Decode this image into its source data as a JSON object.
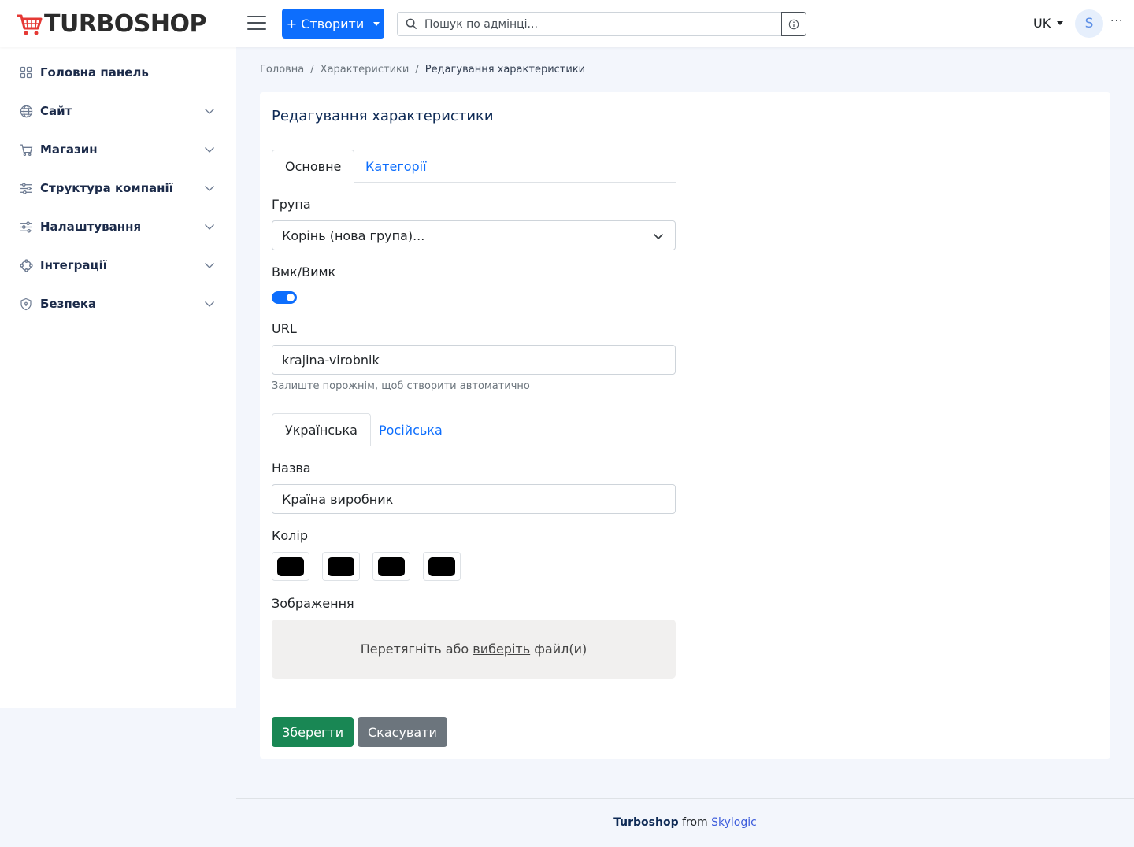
{
  "header": {
    "logo": "TURBOSHOP",
    "create_label": "+ Створити",
    "search_placeholder": "Пошук по адмінці...",
    "language": "UK",
    "avatar_initial": "S",
    "more": "···"
  },
  "sidebar": {
    "items": [
      {
        "label": "Головна панель",
        "icon": "grid-icon",
        "has_children": false
      },
      {
        "label": "Сайт",
        "icon": "globe-icon",
        "has_children": true
      },
      {
        "label": "Магазин",
        "icon": "cart-icon",
        "has_children": true
      },
      {
        "label": "Структура компанії",
        "icon": "sliders-icon",
        "has_children": true
      },
      {
        "label": "Налаштування",
        "icon": "sliders-icon",
        "has_children": true
      },
      {
        "label": "Інтеграції",
        "icon": "integrations-icon",
        "has_children": true
      },
      {
        "label": "Безпека",
        "icon": "shield-icon",
        "has_children": true
      }
    ]
  },
  "breadcrumb": {
    "items": [
      "Головна",
      "Характеристики",
      "Редагування характеристики"
    ]
  },
  "form": {
    "title": "Редагування характеристики",
    "tabs": [
      "Основне",
      "Категорії"
    ],
    "group_label": "Група",
    "group_value": "Корінь (нова група)...",
    "toggle_label": "Вмк/Вимк",
    "toggle_on": true,
    "url_label": "URL",
    "url_value": "krajina-virobnik",
    "url_hint": "Залиште порожнім, щоб створити автоматично",
    "lang_tabs": [
      "Українська",
      "Російська"
    ],
    "name_label": "Назва",
    "name_value": "Країна виробник",
    "color_label": "Колір",
    "colors": [
      "#000000",
      "#000000",
      "#000000",
      "#000000"
    ],
    "image_label": "Зображення",
    "dropzone_before": "Перетягніть або ",
    "dropzone_link": "виберіть",
    "dropzone_after": " файл(и)",
    "save_label": "Зберегти",
    "cancel_label": "Скасувати"
  },
  "footer": {
    "brand": "Turboshop",
    "from": " from ",
    "company": "Skylogic"
  },
  "colors": {
    "primary": "#0d6efd",
    "success": "#198754",
    "secondary": "#6c757d",
    "logo_red": "#e53935"
  }
}
